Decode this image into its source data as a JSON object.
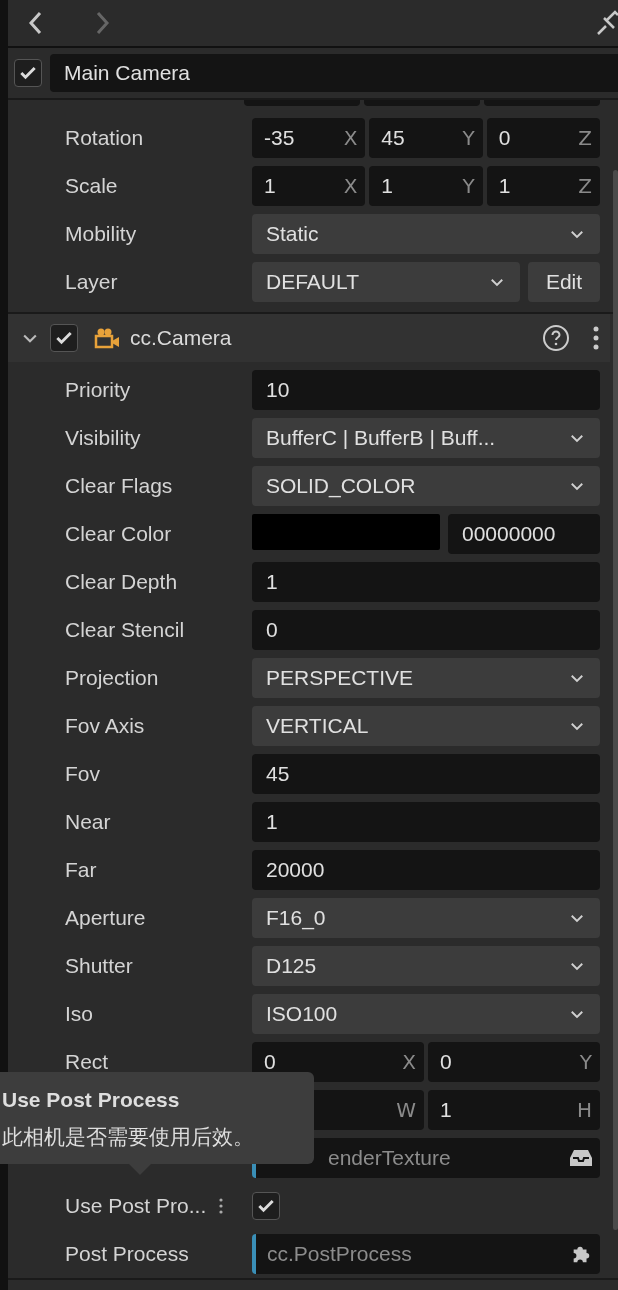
{
  "nav": {
    "back_disabled": false,
    "forward_disabled": true
  },
  "node": {
    "checked": true,
    "name": "Main Camera"
  },
  "transform_rows": [
    {
      "kind": "vec",
      "label": "Rotation",
      "fields": [
        {
          "value": "-35",
          "axis": "X"
        },
        {
          "value": "45",
          "axis": "Y"
        },
        {
          "value": "0",
          "axis": "Z"
        }
      ]
    },
    {
      "kind": "vec",
      "label": "Scale",
      "fields": [
        {
          "value": "1",
          "axis": "X"
        },
        {
          "value": "1",
          "axis": "Y"
        },
        {
          "value": "1",
          "axis": "Z"
        }
      ]
    },
    {
      "kind": "select",
      "label": "Mobility",
      "value": "Static"
    },
    {
      "kind": "select_button",
      "label": "Layer",
      "value": "DEFAULT",
      "button": "Edit"
    }
  ],
  "component": {
    "expanded": true,
    "checked": true,
    "title": "cc.Camera"
  },
  "camera_rows": [
    {
      "kind": "text",
      "label": "Priority",
      "value": "10"
    },
    {
      "kind": "select",
      "label": "Visibility",
      "value": "BufferC | BufferB | Buff..."
    },
    {
      "kind": "select",
      "label": "Clear Flags",
      "value": "SOLID_COLOR"
    },
    {
      "kind": "color",
      "label": "Clear Color",
      "color": "#000000",
      "value": "00000000"
    },
    {
      "kind": "text",
      "label": "Clear Depth",
      "value": "1"
    },
    {
      "kind": "text",
      "label": "Clear Stencil",
      "value": "0"
    },
    {
      "kind": "select",
      "label": "Projection",
      "value": "PERSPECTIVE"
    },
    {
      "kind": "select",
      "label": "Fov Axis",
      "value": "VERTICAL"
    },
    {
      "kind": "text",
      "label": "Fov",
      "value": "45"
    },
    {
      "kind": "text",
      "label": "Near",
      "value": "1"
    },
    {
      "kind": "text",
      "label": "Far",
      "value": "20000"
    },
    {
      "kind": "select",
      "label": "Aperture",
      "value": "F16_0"
    },
    {
      "kind": "select",
      "label": "Shutter",
      "value": "D125"
    },
    {
      "kind": "select",
      "label": "Iso",
      "value": "ISO100"
    },
    {
      "kind": "vec",
      "label": "Rect",
      "fields": [
        {
          "value": "0",
          "axis": "X"
        },
        {
          "value": "0",
          "axis": "Y"
        }
      ]
    },
    {
      "kind": "vec",
      "fields": [
        {
          "axis": "W"
        },
        {
          "value": "1",
          "axis": "H"
        }
      ]
    },
    {
      "kind": "texture",
      "value": "enderTexture"
    },
    {
      "kind": "checkbox",
      "label": "Use Post Pro...",
      "checked": true
    },
    {
      "kind": "reference",
      "label": "Post Process",
      "value": "cc.PostProcess"
    }
  ],
  "tooltip": {
    "title": "Use Post Process",
    "text": "此相机是否需要使用后效。"
  }
}
